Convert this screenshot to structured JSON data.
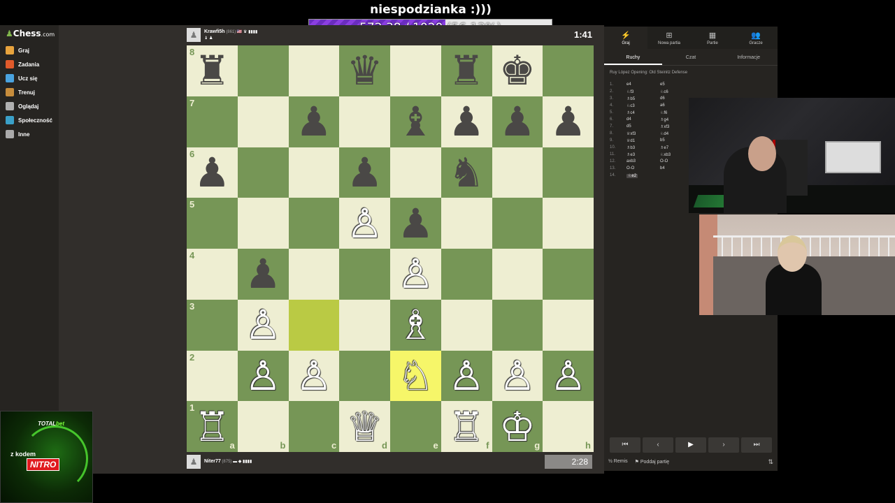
{
  "stream": {
    "title": "niespodzianka :)))",
    "progress_current": "572.38 / 1020",
    "progress_percent": "(56.12%)",
    "progress_fraction": 0.5612
  },
  "sidebar": {
    "logo": "Chess",
    "logo_suffix": ".com",
    "items": [
      {
        "label": "Graj",
        "icon": "play-pawn-icon",
        "color": "#e8a33d"
      },
      {
        "label": "Zadania",
        "icon": "puzzle-icon",
        "color": "#e05a2b"
      },
      {
        "label": "Ucz się",
        "icon": "learn-icon",
        "color": "#4aa3df"
      },
      {
        "label": "Trenuj",
        "icon": "train-icon",
        "color": "#c78d3c"
      },
      {
        "label": "Oglądaj",
        "icon": "watch-icon",
        "color": "#b0b0b0"
      },
      {
        "label": "Społeczność",
        "icon": "community-icon",
        "color": "#3aa0c8"
      },
      {
        "label": "Inne",
        "icon": "more-dots-icon",
        "color": "#aaaaaa"
      }
    ]
  },
  "top_player": {
    "name": "Krawfi5h",
    "rating": "(861)",
    "flags": "🇺🇸 ♛ ▮▮▮▮",
    "captured": "♝ ♟",
    "clock": "1:41"
  },
  "bottom_player": {
    "name": "Niter77",
    "rating": "(875)",
    "flags": "▬ ◆ ▮▮▮▮",
    "clock": "2:28"
  },
  "board": {
    "ranks": [
      "8",
      "7",
      "6",
      "5",
      "4",
      "3",
      "2",
      "1"
    ],
    "files": [
      "a",
      "b",
      "c",
      "d",
      "e",
      "f",
      "g",
      "h"
    ],
    "squares": [
      "♜",
      "",
      "",
      "♛",
      "",
      "♜",
      "♚",
      "",
      "",
      "",
      "♟",
      "",
      "♝",
      "♟",
      "♟",
      "♟",
      "♟",
      "",
      "",
      "♟",
      "",
      "♞",
      "",
      "",
      "",
      "",
      "",
      "♙",
      "♟",
      "",
      "",
      "",
      "",
      "♟",
      "",
      "",
      "♙",
      "",
      "",
      "",
      "",
      "♙",
      "",
      "",
      "♗",
      "",
      "",
      "",
      "",
      "♙",
      "♙",
      "",
      "♘",
      "♙",
      "♙",
      "♙",
      "♖",
      "",
      "",
      "♕",
      "",
      "♖",
      "♔",
      ""
    ],
    "colors": [
      "b",
      "",
      "",
      "b",
      "",
      "b",
      "b",
      "",
      "",
      "",
      "b",
      "",
      "b",
      "b",
      "b",
      "b",
      "b",
      "",
      "",
      "b",
      "",
      "b",
      "",
      "",
      "",
      "",
      "",
      "w",
      "b",
      "",
      "",
      "",
      "",
      "b",
      "",
      "",
      "w",
      "",
      "",
      "",
      "",
      "w",
      "",
      "",
      "w",
      "",
      "",
      "",
      "",
      "w",
      "w",
      "",
      "w",
      "w",
      "w",
      "w",
      "w",
      "",
      "",
      "w",
      "",
      "w",
      "w",
      ""
    ],
    "highlight_from": "c3",
    "highlight_to": "e2",
    "light_color": "#eeeed2",
    "dark_color": "#769656"
  },
  "panel": {
    "tabs": [
      {
        "label": "Graj",
        "icon": "lightning-icon"
      },
      {
        "label": "Nowa partia",
        "icon": "plus-icon"
      },
      {
        "label": "Partie",
        "icon": "board-icon"
      },
      {
        "label": "Gracze",
        "icon": "players-icon"
      }
    ],
    "subtabs": [
      "Ruchy",
      "Czat",
      "Informacje"
    ],
    "opening": "Ruy López Opening: Old Steinitz Defense",
    "moves": [
      {
        "no": "1.",
        "w": "e4",
        "b": "e5"
      },
      {
        "no": "2.",
        "w": "♘f3",
        "b": "♘c6"
      },
      {
        "no": "3.",
        "w": "♗b5",
        "b": "d6"
      },
      {
        "no": "4.",
        "w": "♘c3",
        "b": "a6"
      },
      {
        "no": "5.",
        "w": "♗c4",
        "b": "♘f6"
      },
      {
        "no": "6.",
        "w": "d4",
        "b": "♗g4"
      },
      {
        "no": "7.",
        "w": "d5",
        "b": "♗xf3"
      },
      {
        "no": "8.",
        "w": "♕xf3",
        "b": "♘d4"
      },
      {
        "no": "9.",
        "w": "♕d1",
        "b": "b5"
      },
      {
        "no": "10.",
        "w": "♗b3",
        "b": "♗e7"
      },
      {
        "no": "11.",
        "w": "♗e3",
        "b": "♘xb3"
      },
      {
        "no": "12.",
        "w": "axb3",
        "b": "O-O"
      },
      {
        "no": "13.",
        "w": "O-O",
        "b": "b4"
      },
      {
        "no": "14.",
        "w": "♘e2",
        "b": ""
      }
    ],
    "nav": [
      "⏮",
      "‹",
      "▶",
      "›",
      "⏭"
    ],
    "footer_draw": "Remis",
    "footer_resign": "Poddaj partię",
    "footer_draw_icon": "½",
    "footer_resign_icon": "⚑",
    "flip_icon": "⇅"
  },
  "ad": {
    "brand": "TOTAL",
    "brand_suffix": "bet",
    "with_code": "z kodem",
    "code": "NITRO"
  }
}
